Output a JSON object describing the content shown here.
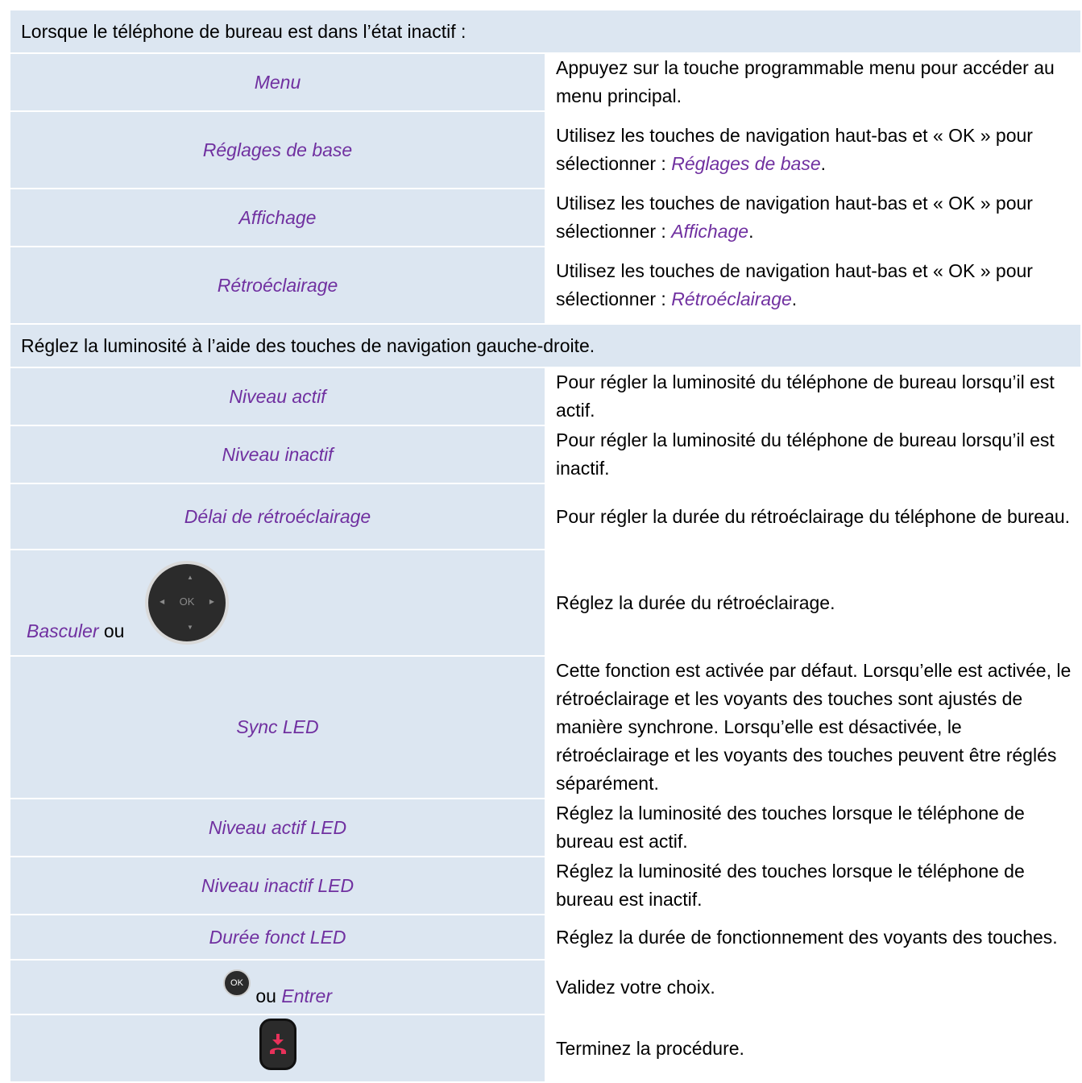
{
  "section1": "Lorsque le téléphone de bureau est dans l’état inactif :",
  "rows1": [
    {
      "label": "Menu",
      "desc": [
        "Appuyez sur la touche programmable menu pour accéder au menu principal."
      ]
    },
    {
      "label": "Réglages de base",
      "desc": [
        "Utilisez les touches de navigation haut-bas et « OK » pour sélectionner : ",
        {
          "hl": "Réglages de base"
        },
        "."
      ]
    },
    {
      "label": "Affichage",
      "desc": [
        "Utilisez les touches de navigation haut-bas et « OK » pour sélectionner : ",
        {
          "hl": "Affichage"
        },
        "."
      ]
    },
    {
      "label": "Rétroéclairage",
      "desc": [
        "Utilisez les touches de navigation haut-bas et « OK » pour sélectionner : ",
        {
          "hl": "Rétroéclairage"
        },
        "."
      ]
    }
  ],
  "section2": "Réglez la luminosité à l’aide des touches de navigation gauche-droite.",
  "rows2": [
    {
      "label": "Niveau actif",
      "desc": "Pour régler la luminosité du téléphone de bureau lorsqu’il est actif."
    },
    {
      "label": "Niveau inactif",
      "desc": "Pour régler la luminosité du téléphone de bureau lorsqu’il est inactif."
    },
    {
      "label": "Délai de rétroéclairage",
      "desc": "Pour régler la durée du rétroéclairage du téléphone de bureau."
    }
  ],
  "toggle_row": {
    "label": "Basculer",
    "or": "ou",
    "navpad_ok": "OK",
    "navpad_icon": "navigation-pad-icon",
    "desc": "Réglez la durée du rétroéclairage."
  },
  "rows3": [
    {
      "label": "Sync LED",
      "desc": "Cette fonction est activée par défaut. Lorsqu’elle est activée, le rétroéclairage et les voyants des touches sont ajustés de manière synchrone. Lorsqu’elle est désactivée, le rétroéclairage et les voyants des touches peuvent être réglés séparément."
    },
    {
      "label": "Niveau actif LED",
      "desc": "Réglez la luminosité des touches lorsque le téléphone de bureau est actif."
    },
    {
      "label": "Niveau inactif LED",
      "desc": "Réglez la luminosité des touches lorsque le téléphone de bureau est inactif."
    },
    {
      "label": "Durée fonct LED",
      "desc": "Réglez la durée de fonctionnement des voyants des touches."
    }
  ],
  "ok_row": {
    "ok_icon": "ok-button-icon",
    "ok_text": "OK",
    "or": "ou",
    "label": "Entrer",
    "desc": "Validez votre choix."
  },
  "end_row": {
    "icon": "hang-up-button-icon",
    "desc": "Terminez la procédure."
  },
  "colors": {
    "section_bg": "#dce6f1",
    "label_text": "#7030a0",
    "hang_up_red": "#e8315a"
  }
}
